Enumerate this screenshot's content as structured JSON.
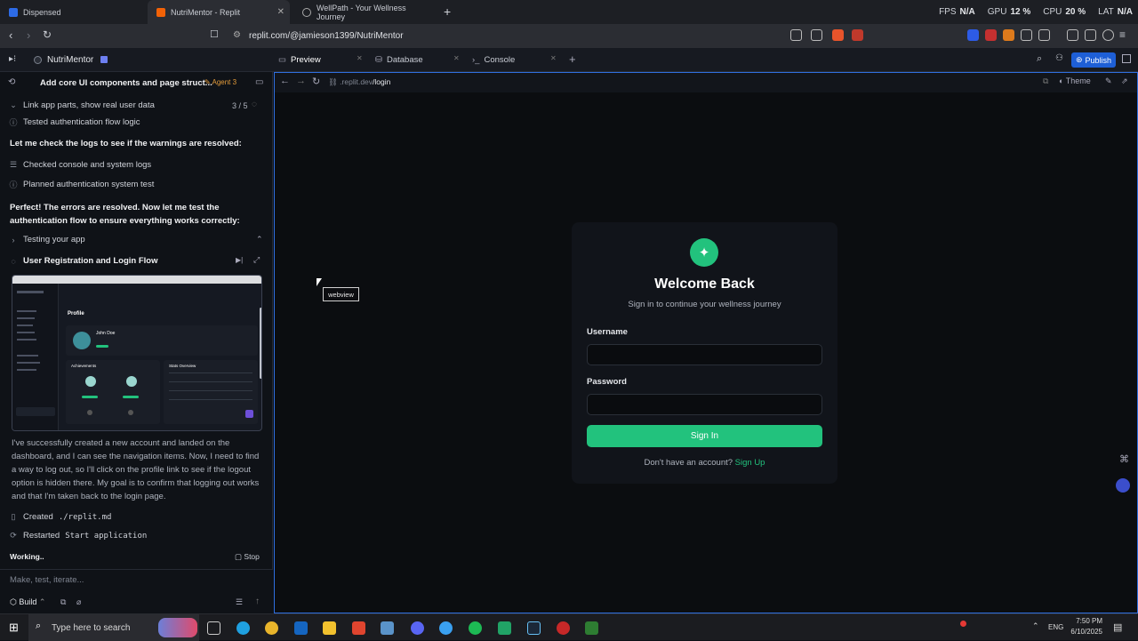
{
  "browser": {
    "tabs": [
      {
        "label": "Dispensed",
        "active": false
      },
      {
        "label": "NutriMentor - Replit",
        "active": true
      },
      {
        "label": "WellPath - Your Wellness Journey",
        "active": false
      }
    ],
    "perf": {
      "fps_label": "FPS",
      "fps_value": "N/A",
      "gpu_label": "GPU",
      "gpu_value": "12 %",
      "cpu_label": "CPU",
      "cpu_value": "20 %",
      "lat_label": "LAT",
      "lat_value": "N/A"
    },
    "url": "replit.com/@jamieson1399/NutriMentor"
  },
  "replit": {
    "project_name": "NutriMentor",
    "tabs": [
      {
        "label": "Preview",
        "selected": true
      },
      {
        "label": "Database",
        "selected": false
      },
      {
        "label": "Console",
        "selected": false
      }
    ],
    "publish_label": "Publish"
  },
  "agent": {
    "task_title": "Add core UI components and page struct...",
    "agent_badge": "Agent 3",
    "step_title": "Link app parts, show real user data",
    "step_count": "3 / 5",
    "items": {
      "tested": "Tested authentication flow logic",
      "check_logs": "Let me check the logs to see if the warnings are resolved:",
      "checked": "Checked console and system logs",
      "planned": "Planned authentication system test",
      "perfect": "Perfect! The errors are resolved. Now let me test the authentication flow to ensure everything works correctly:",
      "testing": "Testing your app",
      "flow": "User Registration and Login Flow",
      "paragraph": "I've successfully created a new account and landed on the dashboard, and I can see the navigation items. Now, I need to find a way to log out, so I'll click on the profile link to see if the logout option is hidden there. My goal is to confirm that logging out works and that I'm taken back to the login page.",
      "created_prefix": "Created",
      "created_file": "./replit.md",
      "restarted_prefix": "Restarted",
      "restarted_name": "Start application",
      "working": "Working..",
      "stop": "Stop"
    },
    "thumbnail": {
      "profile_title": "Profile",
      "user_name": "John Doe",
      "achievements": "Achievements",
      "stats": "Stats Overview"
    },
    "input_placeholder": "Make, test, iterate...",
    "build_label": "Build"
  },
  "preview": {
    "url_prefix": ".replit.dev",
    "url_path": "/login",
    "theme_label": "Theme",
    "tooltip": "webview",
    "login": {
      "title": "Welcome Back",
      "subtitle": "Sign in to continue your wellness journey",
      "username_label": "Username",
      "password_label": "Password",
      "signin_label": "Sign In",
      "no_account": "Don't have an account?",
      "signup_link": "Sign Up"
    }
  },
  "taskbar": {
    "search_placeholder": "Type here to search",
    "lang": "ENG",
    "time": "7:50 PM",
    "date": "6/10/2025"
  },
  "colors": {
    "accent_green": "#22c27d",
    "publish_blue": "#1e5fd6",
    "preview_border": "#2f6fe0"
  }
}
